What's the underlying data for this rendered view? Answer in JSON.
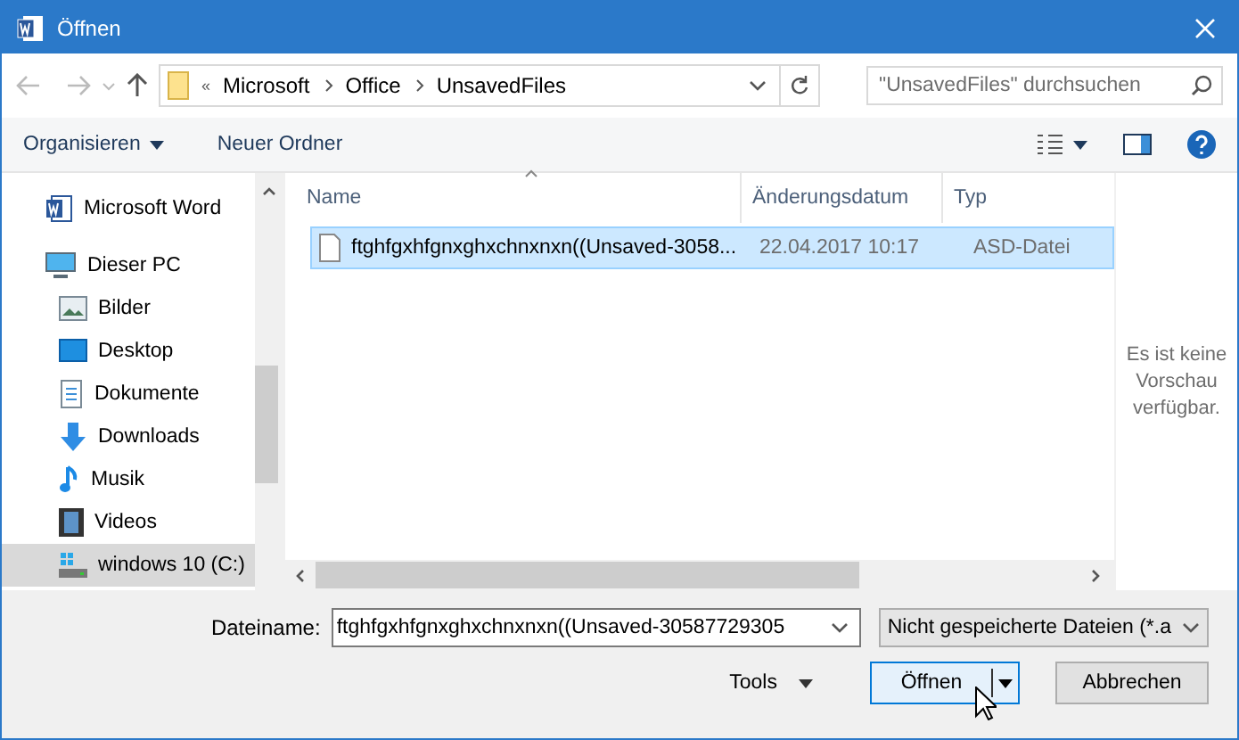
{
  "window": {
    "title": "Öffnen"
  },
  "address": {
    "prefix": "«",
    "crumbs": [
      "Microsoft",
      "Office",
      "UnsavedFiles"
    ]
  },
  "search": {
    "placeholder": "\"UnsavedFiles\" durchsuchen"
  },
  "toolbar": {
    "organize": "Organisieren",
    "new_folder": "Neuer Ordner"
  },
  "sidebar": {
    "items": [
      {
        "label": "Microsoft Word",
        "kind": "app",
        "selected": false
      },
      {
        "label": "Dieser PC",
        "kind": "pc",
        "selected": false,
        "children": [
          {
            "label": "Bilder",
            "kind": "pictures",
            "selected": false
          },
          {
            "label": "Desktop",
            "kind": "desktop",
            "selected": false
          },
          {
            "label": "Dokumente",
            "kind": "documents",
            "selected": false
          },
          {
            "label": "Downloads",
            "kind": "downloads",
            "selected": false
          },
          {
            "label": "Musik",
            "kind": "music",
            "selected": false
          },
          {
            "label": "Videos",
            "kind": "videos",
            "selected": false
          },
          {
            "label": "windows 10 (C:)",
            "kind": "drive",
            "selected": true
          }
        ]
      }
    ]
  },
  "table": {
    "columns": [
      "Name",
      "Änderungsdatum",
      "Typ"
    ],
    "rows": [
      {
        "name": "ftghfgxhfgnxghxchnxnxn((Unsaved-3058...",
        "date": "22.04.2017 10:17",
        "type": "ASD-Datei",
        "selected": true
      }
    ]
  },
  "preview": {
    "message": "Es ist keine Vorschau verfügbar."
  },
  "footer": {
    "filename_label": "Dateiname:",
    "filename": "ftghfgxhfgnxghxchnxnxn((Unsaved-30587729305",
    "filetype": "Nicht gespeicherte Dateien (*.a",
    "tools": "Tools",
    "open": "Öffnen",
    "cancel": "Abbrechen"
  }
}
